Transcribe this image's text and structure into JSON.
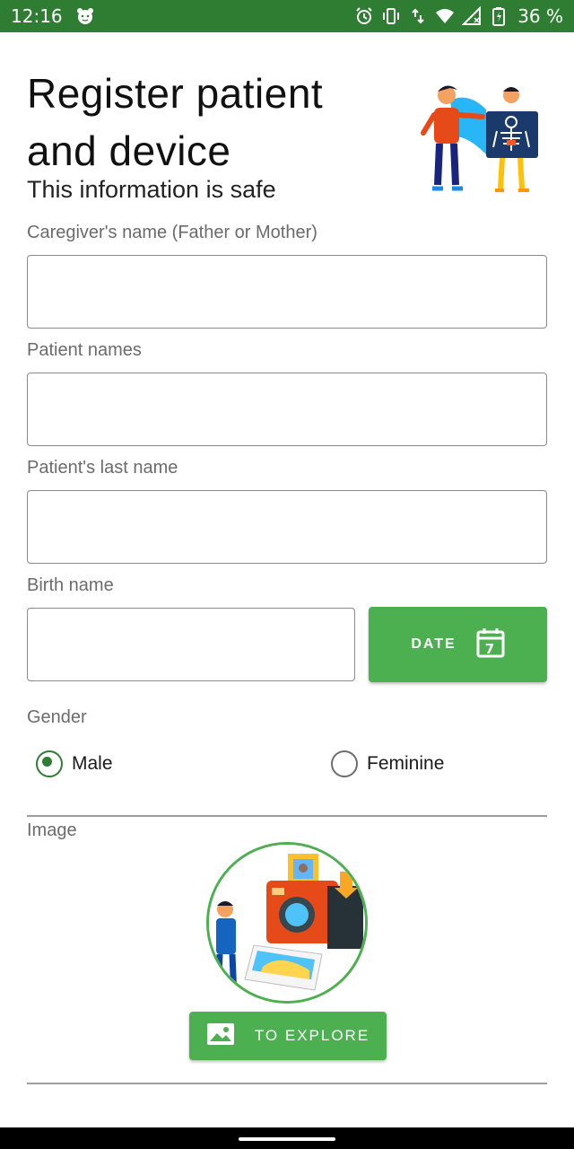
{
  "status": {
    "time": "12:16",
    "battery": "36 %"
  },
  "header": {
    "title": "Register patient and device",
    "subtitle": "This information is safe"
  },
  "form": {
    "caregiver": {
      "label": "Caregiver's name (Father or Mother)",
      "value": "",
      "placeholder": ""
    },
    "patient_names": {
      "label": "Patient names",
      "value": "",
      "placeholder": ""
    },
    "last_name": {
      "label": "Patient's last name",
      "value": "",
      "placeholder": ""
    },
    "birth": {
      "label": "Birth name",
      "value": "",
      "placeholder": "",
      "date_button": "DATE",
      "calendar_day": "7"
    },
    "gender": {
      "label": "Gender",
      "options": [
        "Male",
        "Feminine"
      ],
      "selected": "Male"
    },
    "image": {
      "label": "Image",
      "explore_button": "TO EXPLORE"
    }
  },
  "colors": {
    "status_bar": "#2e7d32",
    "accent": "#4caf50",
    "radio_checked": "#2e7d32"
  },
  "icons": [
    "face-icon",
    "alarm-icon",
    "vibrate-icon",
    "data-arrows-icon",
    "wifi-icon",
    "signal-icon",
    "battery-charging-icon",
    "calendar-icon",
    "image-icon"
  ]
}
